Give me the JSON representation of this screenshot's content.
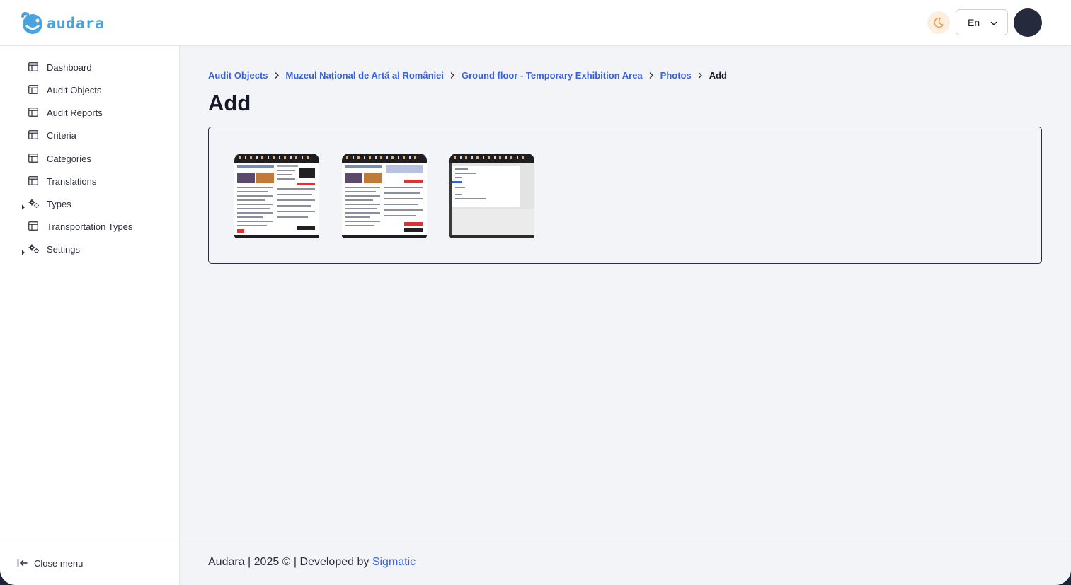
{
  "header": {
    "logo_text": "audara",
    "language": "En",
    "theme_icon": "moon-icon",
    "brand_color": "#4aa3df",
    "avatar_color": "#262a3d"
  },
  "sidebar": {
    "items": [
      {
        "label": "Dashboard",
        "icon": "table-icon",
        "expandable": false
      },
      {
        "label": "Audit Objects",
        "icon": "table-icon",
        "expandable": false
      },
      {
        "label": "Audit Reports",
        "icon": "table-icon",
        "expandable": false
      },
      {
        "label": "Criteria",
        "icon": "table-icon",
        "expandable": false
      },
      {
        "label": "Categories",
        "icon": "table-icon",
        "expandable": false
      },
      {
        "label": "Translations",
        "icon": "table-icon",
        "expandable": false
      },
      {
        "label": "Types",
        "icon": "gears-icon",
        "expandable": true
      },
      {
        "label": "Transportation Types",
        "icon": "table-icon",
        "expandable": false
      },
      {
        "label": "Settings",
        "icon": "gears-icon",
        "expandable": true
      }
    ],
    "close_menu_label": "Close menu"
  },
  "main": {
    "breadcrumb": [
      {
        "label": "Audit Objects",
        "link": true
      },
      {
        "label": "Muzeul Național de Artă al României",
        "link": true
      },
      {
        "label": "Ground floor - Temporary Exhibition Area",
        "link": true
      },
      {
        "label": "Photos",
        "link": true
      },
      {
        "label": "Add",
        "link": false
      }
    ],
    "title": "Add",
    "photos": [
      {
        "name": "photo-thumbnail-1",
        "variant": "news"
      },
      {
        "name": "photo-thumbnail-2",
        "variant": "news"
      },
      {
        "name": "photo-thumbnail-3",
        "variant": "app"
      }
    ]
  },
  "footer": {
    "text": "Audara | 2025 © | Developed by",
    "developer": "Sigmatic",
    "link_color": "#3a62d8"
  }
}
